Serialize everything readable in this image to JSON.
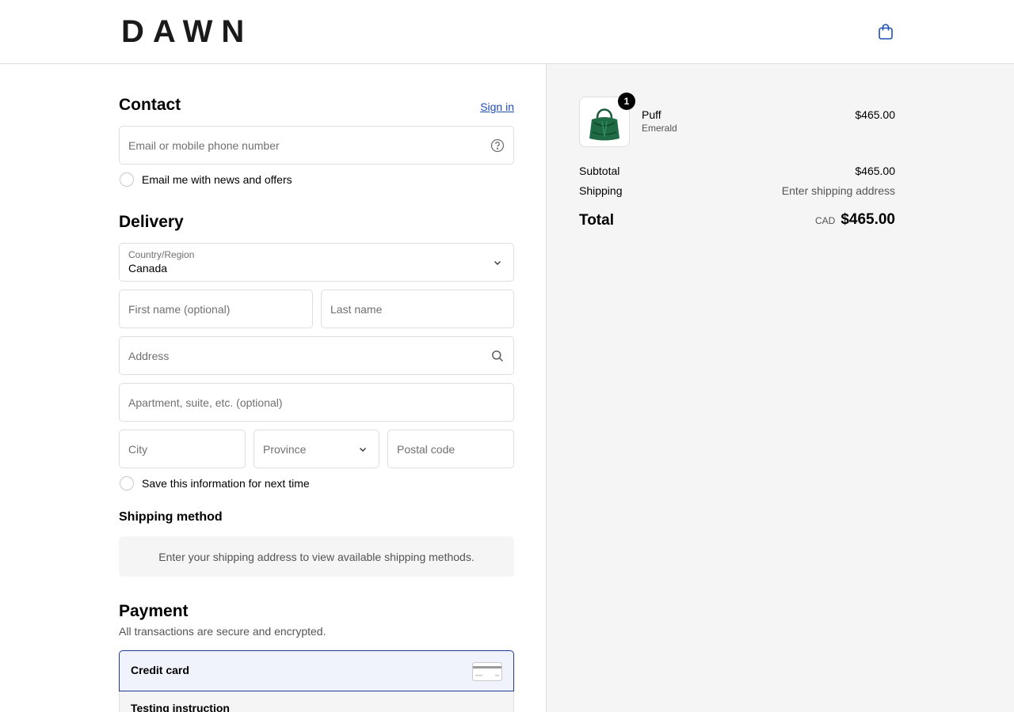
{
  "header": {
    "brand": "DAWN",
    "cart_icon": "shopping-bag-icon",
    "accent_color": "#1f4fb3"
  },
  "contact": {
    "title": "Contact",
    "sign_in": "Sign in",
    "email_placeholder": "Email or mobile phone number",
    "help_icon": "question-circle-icon",
    "news_checkbox": "Email me with news and offers"
  },
  "delivery": {
    "title": "Delivery",
    "country_label": "Country/Region",
    "country_value": "Canada",
    "first_name_placeholder": "First name (optional)",
    "last_name_placeholder": "Last name",
    "address_placeholder": "Address",
    "apartment_placeholder": "Apartment, suite, etc. (optional)",
    "city_placeholder": "City",
    "province_placeholder": "Province",
    "postal_placeholder": "Postal code",
    "save_checkbox": "Save this information for next time"
  },
  "shipping_method": {
    "title": "Shipping method",
    "message": "Enter your shipping address to view available shipping methods."
  },
  "payment": {
    "title": "Payment",
    "subtitle": "All transactions are secure and encrypted.",
    "option_label": "Credit card",
    "testing_label": "Testing instruction"
  },
  "summary": {
    "product": {
      "name": "Puff",
      "variant": "Emerald",
      "quantity": "1",
      "price": "$465.00"
    },
    "subtotal_label": "Subtotal",
    "subtotal_value": "$465.00",
    "shipping_label": "Shipping",
    "shipping_value": "Enter shipping address",
    "total_label": "Total",
    "currency": "CAD",
    "total_value": "$465.00"
  }
}
